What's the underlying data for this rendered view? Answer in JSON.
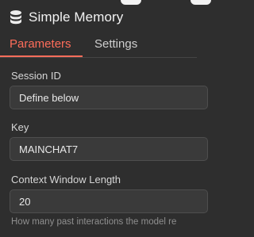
{
  "header": {
    "title": "Simple Memory",
    "icon": "database-icon"
  },
  "tabs": [
    {
      "label": "Parameters",
      "active": true
    },
    {
      "label": "Settings",
      "active": false
    }
  ],
  "fields": {
    "session_id": {
      "label": "Session ID",
      "value": "Define below"
    },
    "key": {
      "label": "Key",
      "value": "MAINCHAT7"
    },
    "context_window": {
      "label": "Context Window Length",
      "value": "20",
      "hint": "How many past interactions the model re"
    }
  },
  "colors": {
    "background": "#2e2e2e",
    "accent": "#ff6d5a",
    "field_bg": "#3a3a3a"
  }
}
